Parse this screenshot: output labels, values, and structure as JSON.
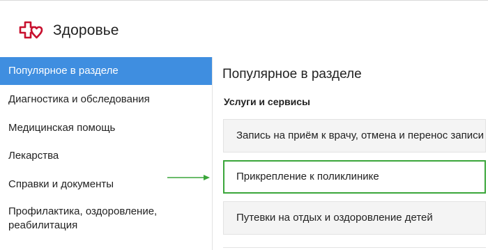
{
  "header": {
    "title": "Здоровье",
    "logo_icon": "health-heart-cross-icon",
    "logo_color": "#c8102e"
  },
  "sidebar": {
    "active_color": "#3f8ee0",
    "items": [
      {
        "label": "Популярное в разделе",
        "active": true
      },
      {
        "label": "Диагностика и обследования",
        "active": false
      },
      {
        "label": "Медицинская помощь",
        "active": false
      },
      {
        "label": "Лекарства",
        "active": false
      },
      {
        "label": "Справки и документы",
        "active": false
      },
      {
        "label": "Профилактика, оздоровление,",
        "label2": "реабилитация",
        "active": false
      }
    ]
  },
  "main": {
    "title": "Популярное в разделе",
    "section_title": "Услуги и сервисы",
    "highlight_color": "#3aa63a",
    "services": [
      {
        "label": "Запись на приём к врачу, отмена и перенос записи"
      },
      {
        "label": "Прикрепление к поликлинике",
        "highlighted": true
      },
      {
        "label": "Путевки на отдых и оздоровление детей"
      }
    ]
  },
  "annotation": {
    "arrow_icon": "green-pointer-arrow-icon",
    "color": "#3aa63a"
  }
}
